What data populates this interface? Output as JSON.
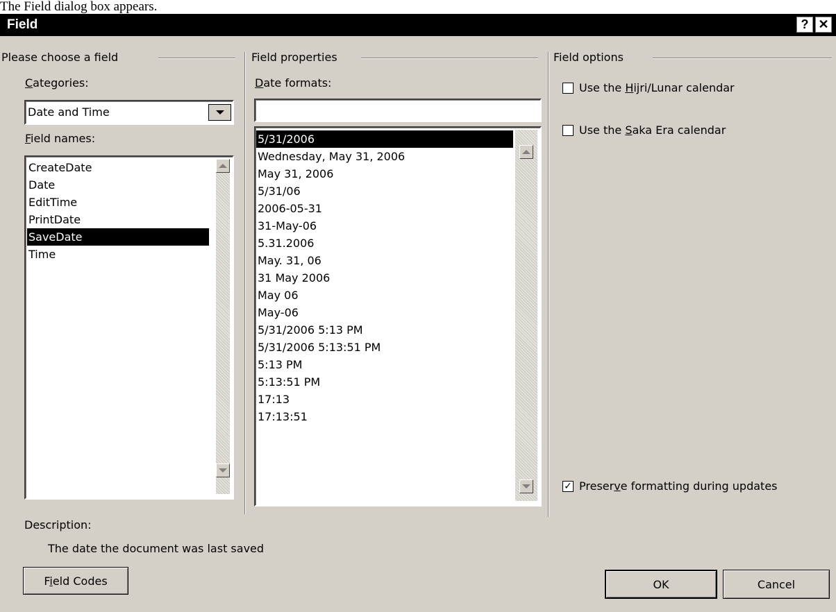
{
  "page_caption": "The Field dialog box appears.",
  "dialog": {
    "title": "Field",
    "help_glyph": "?",
    "close_glyph": "✕"
  },
  "choose_field": {
    "group_label": "Please choose a field",
    "categories_label_pre": "",
    "categories_label_accel": "C",
    "categories_label_post": "ategories:",
    "categories_value": "Date and Time",
    "field_names_label_accel": "F",
    "field_names_label_post": "ield names:",
    "field_names": [
      "CreateDate",
      "Date",
      "EditTime",
      "PrintDate",
      "SaveDate",
      "Time"
    ],
    "selected_field": "SaveDate"
  },
  "field_properties": {
    "group_label": "Field properties",
    "date_formats_label_accel": "D",
    "date_formats_label_post": "ate formats:",
    "date_format_input_value": "",
    "date_formats": [
      "5/31/2006",
      "Wednesday, May 31, 2006",
      "May 31, 2006",
      "5/31/06",
      "2006-05-31",
      "31-May-06",
      "5.31.2006",
      "May. 31, 06",
      "31 May 2006",
      "May 06",
      "May-06",
      "5/31/2006 5:13 PM",
      "5/31/2006 5:13:51 PM",
      "5:13 PM",
      "5:13:51 PM",
      "17:13",
      "17:13:51"
    ],
    "selected_format": "5/31/2006"
  },
  "field_options": {
    "group_label": "Field options",
    "hijri": {
      "pre": "Use the ",
      "accel": "H",
      "post": "ijri/Lunar calendar",
      "checked": false
    },
    "saka": {
      "pre": "Use the ",
      "accel": "S",
      "post": "aka Era calendar",
      "checked": false
    },
    "preserve": {
      "pre": "Preser",
      "accel": "v",
      "post": "e formatting during updates",
      "checked": true,
      "check_glyph": "✓"
    }
  },
  "description": {
    "label": "Description:",
    "text": "The date the document was last saved"
  },
  "buttons": {
    "field_codes_pre": "F",
    "field_codes_accel": "i",
    "field_codes_post": "eld Codes",
    "ok": "OK",
    "cancel": "Cancel"
  },
  "icons": {
    "scroll_up": "triangle-up",
    "scroll_down": "triangle-down",
    "dropdown": "triangle-down"
  }
}
